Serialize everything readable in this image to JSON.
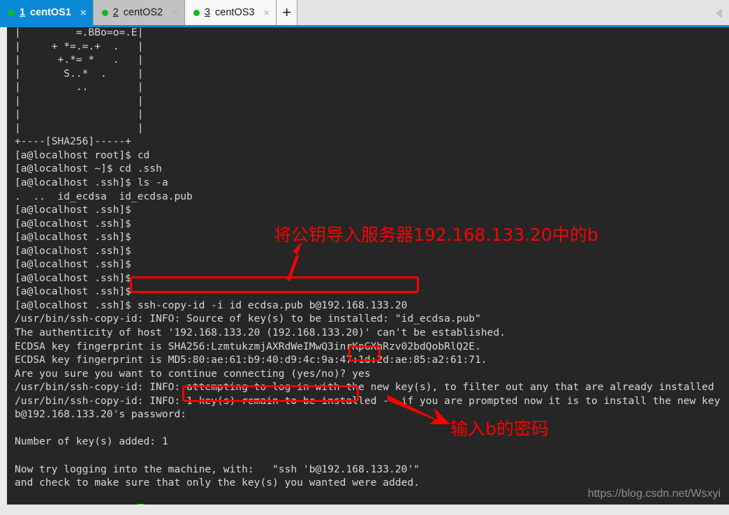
{
  "window": {
    "accent_color": "#0a8ad6",
    "terminal_bg": "#262626",
    "terminal_fg": "#d8d8d8",
    "annotation_color": "#ff0000",
    "cursor_color": "#00e800"
  },
  "tabbar": {
    "tabs": [
      {
        "number": "1",
        "label": "centOS1",
        "state": "active",
        "close_glyph": "×",
        "status": "connected"
      },
      {
        "number": "2",
        "label": "centOS2",
        "state": "hovered",
        "close_glyph": "×",
        "status": "connected"
      },
      {
        "number": "3",
        "label": "centOS3",
        "state": "inactive",
        "close_glyph": "×",
        "status": "connected"
      }
    ],
    "add_tab_label": "+",
    "scroll_left_name": "chevron-left-icon"
  },
  "terminal": {
    "lines": [
      "|         =.BBo=o=.E|",
      "|     + *=.=.+  .   |",
      "|      +.*= *   .   |",
      "|       S..*  .     |",
      "|         ..        |",
      "|                   |",
      "|                   |",
      "|                   |",
      "+----[SHA256]-----+",
      "[a@localhost root]$ cd",
      "[a@localhost ~]$ cd .ssh",
      "[a@localhost .ssh]$ ls -a",
      ".  ..  id_ecdsa  id_ecdsa.pub",
      "[a@localhost .ssh]$",
      "[a@localhost .ssh]$",
      "[a@localhost .ssh]$",
      "[a@localhost .ssh]$",
      "[a@localhost .ssh]$",
      "[a@localhost .ssh]$",
      "[a@localhost .ssh]$",
      "[a@localhost .ssh]$ ssh-copy-id -i id ecdsa.pub b@192.168.133.20",
      "/usr/bin/ssh-copy-id: INFO: Source of key(s) to be installed: \"id_ecdsa.pub\"",
      "The authenticity of host '192.168.133.20 (192.168.133.20)' can't be established.",
      "ECDSA key fingerprint is SHA256:LzmtukzmjAXRdWeIMwQ3inrKpGXhRzv02bdQobRlQ2E.",
      "ECDSA key fingerprint is MD5:80:ae:61:b9:40:d9:4c:9a:47:1d:2d:ae:85:a2:61:71.",
      "Are you sure you want to continue connecting (yes/no)? yes",
      "/usr/bin/ssh-copy-id: INFO: attempting to log in with the new key(s), to filter out any that are already installed",
      "/usr/bin/ssh-copy-id: INFO: 1 key(s) remain to be installed -- if you are prompted now it is to install the new key",
      "b@192.168.133.20's password:",
      "",
      "Number of key(s) added: 1",
      "",
      "Now try logging into the machine, with:   \"ssh 'b@192.168.133.20'\"",
      "and check to make sure that only the key(s) you wanted were added.",
      "",
      "[a@localhost .ssh]$ "
    ],
    "watermark": "https://blog.csdn.net/Wsxyi"
  },
  "annotations": {
    "note_import_key": "将公钥导入服务器192.168.133.20中的b",
    "note_enter_password": "输入b的密码",
    "highlight_command": "ssh-copy-id -i id ecdsa.pub b@192.168.133.20",
    "highlight_yes": "yes",
    "highlight_password_field": ""
  },
  "bottom_strip": {
    "text": ""
  }
}
